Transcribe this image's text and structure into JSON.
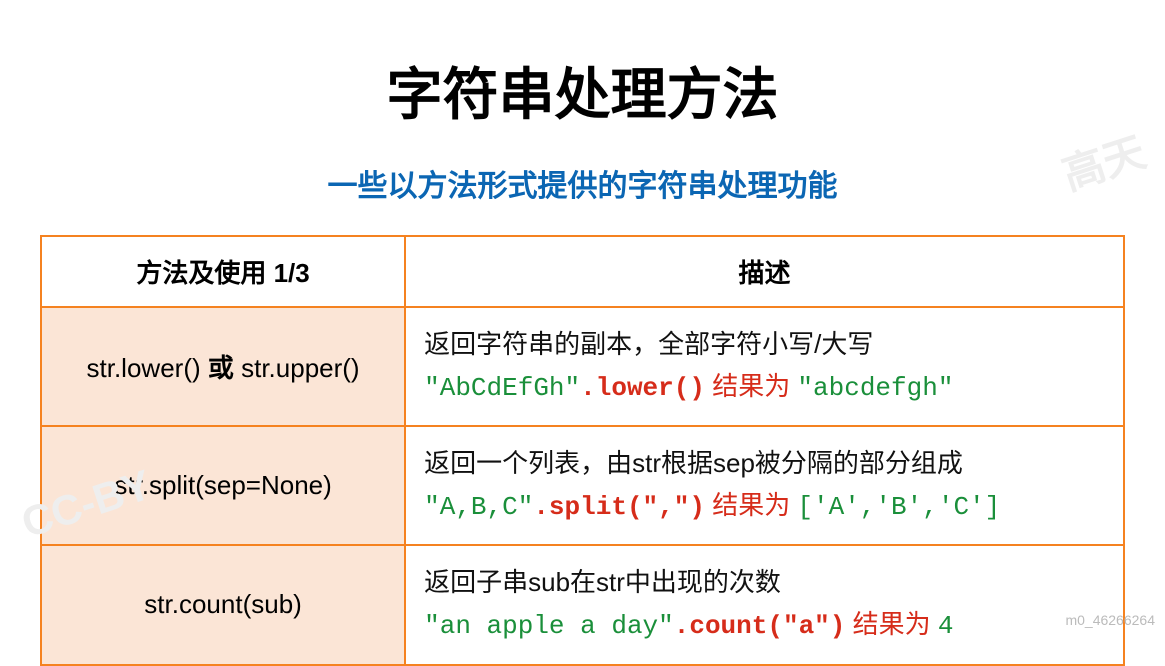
{
  "title": "字符串处理方法",
  "subtitle": "一些以方法形式提供的字符串处理功能",
  "table": {
    "headers": {
      "col1": "方法及使用 1/3",
      "col2": "描述"
    },
    "rows": [
      {
        "method_pre": "str.lower() ",
        "method_mid": "或",
        "method_post": " str.upper()",
        "desc": "返回字符串的副本，全部字符小写/大写",
        "example_str": "\"AbCdEfGh\"",
        "example_call": ".lower()",
        "example_sep": " 结果为 ",
        "example_result": "\"abcdefgh\""
      },
      {
        "method_pre": "str.split(sep=None)",
        "method_mid": "",
        "method_post": "",
        "desc": "返回一个列表，由str根据sep被分隔的部分组成",
        "example_str": "\"A,B,C\"",
        "example_call": ".split(\",\")",
        "example_sep": " 结果为 ",
        "example_result": "['A','B','C']"
      },
      {
        "method_pre": "str.count(sub)",
        "method_mid": "",
        "method_post": "",
        "desc": "返回子串sub在str中出现的次数",
        "example_str": "\"an apple a day\"",
        "example_call": ".count(\"a\")",
        "example_sep": " 结果为 ",
        "example_result": "4"
      }
    ]
  },
  "watermark1": "高天",
  "watermark2": "CC-BY",
  "footer": "m0_46266264"
}
